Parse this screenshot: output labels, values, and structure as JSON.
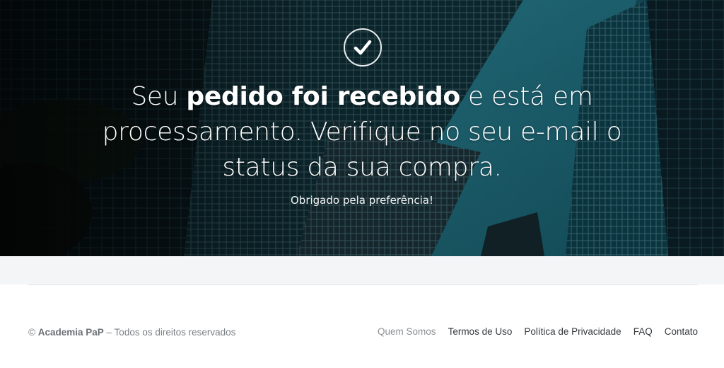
{
  "hero": {
    "check_icon": "check-icon",
    "headline_before": "Seu ",
    "headline_bold": "pedido foi recebido",
    "headline_after": " e está em processamento. Verifique no seu e-mail o status da sua compra.",
    "subline": "Obrigado pela preferência!"
  },
  "footer": {
    "copyright_symbol": "©",
    "brand": "Academia PaP",
    "rights": "– Todos os direitos reservados",
    "links": [
      {
        "label": "Quem Somos"
      },
      {
        "label": "Termos de Uso"
      },
      {
        "label": "Política de Privacidade"
      },
      {
        "label": "FAQ"
      },
      {
        "label": "Contato"
      }
    ]
  },
  "colors": {
    "hero_teal": "#1a6272",
    "footer_text": "#7a7f84",
    "link_text": "#34383c",
    "band_grey": "#f4f5f6"
  }
}
